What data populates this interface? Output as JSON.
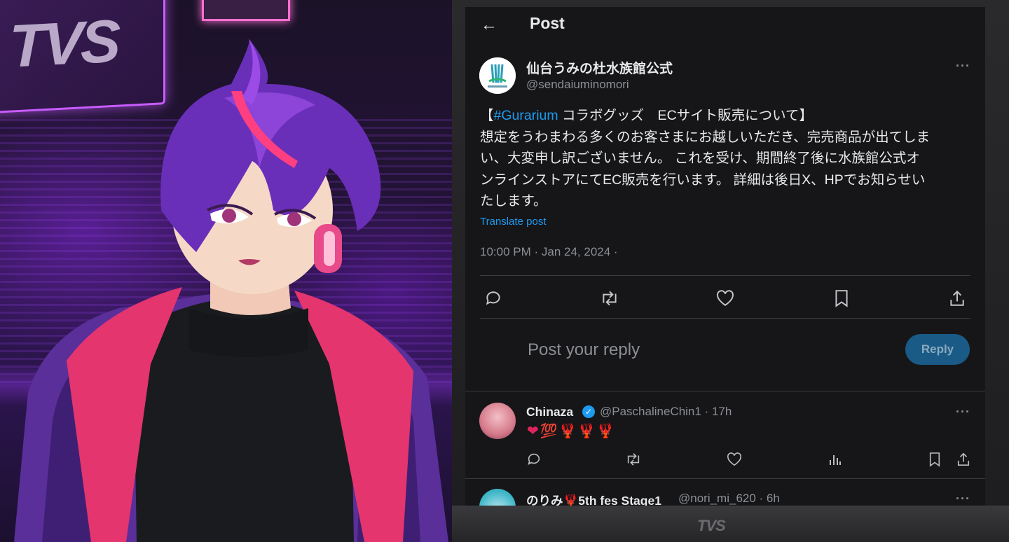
{
  "stream": {
    "sign_text": "TVS",
    "monitor_brand": "TVS"
  },
  "post_view": {
    "header_title": "Post",
    "author": {
      "display_name": "仙台うみの杜水族館公式",
      "handle": "@sendaiuminomori"
    },
    "body": {
      "line1_open": "【",
      "hashtag": "#Gurarium",
      "line1_rest": " コラボグッズ　ECサイト販売について】",
      "line2": "想定をうわまわる多くのお客さまにお越しいただき、完売商品が出てしま",
      "line3": "い、大変申し訳ございません。 これを受け、期間終了後に水族館公式オ",
      "line4": "ンラインストアにてEC販売を行います。 詳細は後日X、HPでお知らせい",
      "line5": "たします。"
    },
    "translate_label": "Translate post",
    "timestamp": "10:00 PM · Jan 24, 2024 ·",
    "actions": [
      "reply-icon",
      "repost-icon",
      "like-icon",
      "bookmark-icon",
      "share-icon"
    ],
    "composer": {
      "placeholder": "Post your reply",
      "button_label": "Reply"
    },
    "replies": [
      {
        "name": "Chinaza",
        "verified": true,
        "handle_time": "@PaschalineChin1 · 17h",
        "text": "❤💯🦞🦞🦞"
      },
      {
        "name": "のりみ🦞5th fes Stage1",
        "verified": false,
        "handle_time": "@nori_mi_620 · 6h",
        "text": ""
      }
    ]
  },
  "colors": {
    "accent_blue": "#1d9bf0",
    "screen_bg": "#161618",
    "muted_text": "#8b8f94",
    "neon_purple": "#c85cff"
  }
}
